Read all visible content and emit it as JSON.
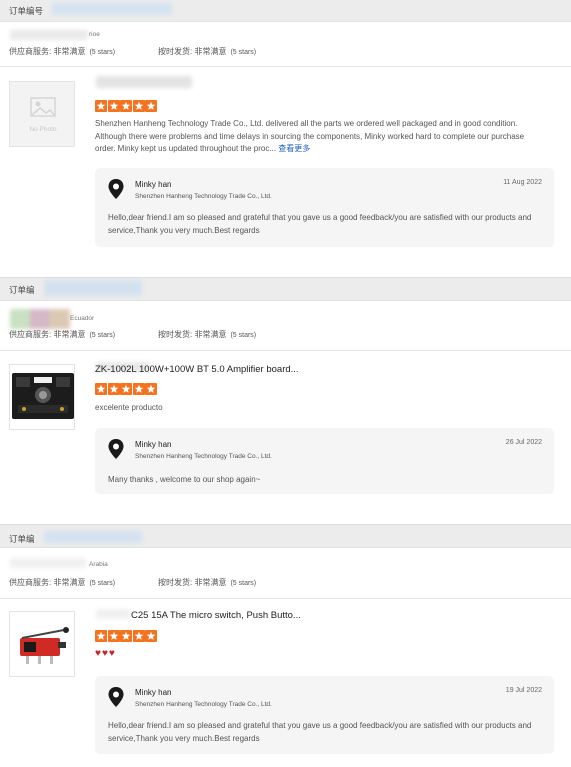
{
  "orders": [
    {
      "order_label": "订单编号",
      "country": "rioe",
      "supplier_service": "供应商服务: 非常满意",
      "supplier_rating": "(5 stars)",
      "shipping": "按时发货: 非常满意",
      "shipping_rating": "(5 stars)",
      "product_title": "",
      "thumb_placeholder": "No Photo",
      "stars": 5,
      "review": "Shenzhen Hanheng Technology Trade Co., Ltd. delivered all the parts we ordered well packaged and in good condition. Although there were problems and time delays in sourcing the components, Minky worked hard to complete our purchase order. Minky kept us updated throughout the proc...",
      "more_link": "查看更多",
      "reply": {
        "name": "Minky han",
        "shop": "Shenzhen Hanheng Technology Trade Co., Ltd.",
        "date": "11 Aug 2022",
        "message": "Hello,dear friend.I am so pleased and grateful that you gave us a good feedback/you are satisfied with our products and service,Thank you very much.Best regards"
      }
    },
    {
      "order_label": "订单编",
      "country": "Ecuador",
      "supplier_service": "供应商服务: 非常满意",
      "supplier_rating": "(5 stars)",
      "shipping": "按时发货: 非常满意",
      "shipping_rating": "(5 stars)",
      "product_title": "ZK-1002L 100W+100W BT 5.0 Amplifier board...",
      "stars": 5,
      "review": "excelente producto",
      "reply": {
        "name": "Minky han",
        "shop": "Shenzhen Hanheng Technology Trade Co., Ltd.",
        "date": "26 Jul 2022",
        "message": "Many thanks , welcome to our shop again~"
      }
    },
    {
      "order_label": "订单编",
      "country": "Arabia",
      "supplier_service": "供应商服务: 非常满意",
      "supplier_rating": "(5 stars)",
      "shipping": "按时发货: 非常满意",
      "shipping_rating": "(5 stars)",
      "product_title": "C25 15A The micro switch, Push Butto...",
      "stars": 5,
      "hearts": "♥♥♥",
      "reply": {
        "name": "Minky han",
        "shop": "Shenzhen Hanheng Technology Trade Co., Ltd.",
        "date": "19 Jul 2022",
        "message": "Hello,dear friend.I am so pleased and grateful that you gave us a good feedback/you are satisfied with our products and service,Thank you very much.Best regards"
      }
    }
  ],
  "colors": {
    "star": "#f47321",
    "link": "#1f5fbf",
    "heart": "#c0262c",
    "header_bg": "#ececec",
    "reply_bg": "#f5f5f5"
  },
  "icons": {
    "star": "star-icon",
    "location": "location-pin-icon",
    "heart": "heart-icon"
  }
}
